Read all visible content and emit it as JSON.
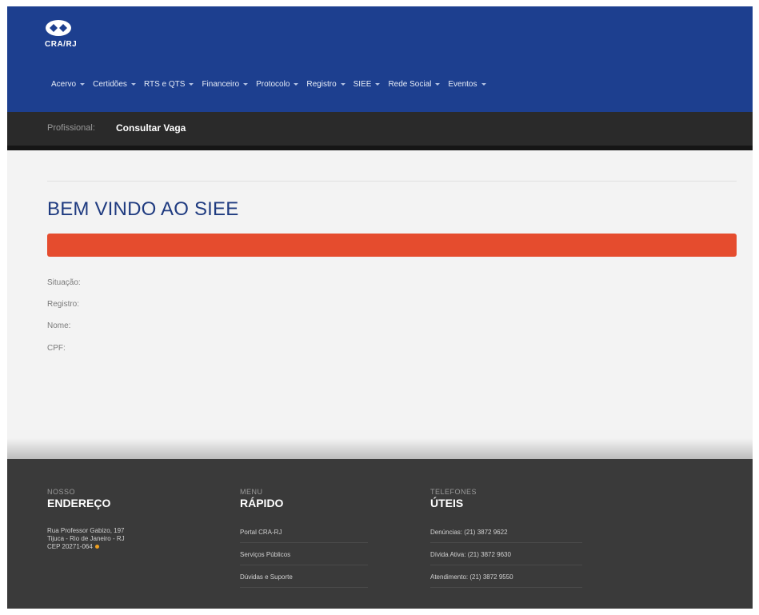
{
  "brand": {
    "logo_text": "CRA/RJ"
  },
  "nav": {
    "items": [
      {
        "label": "Acervo"
      },
      {
        "label": "Certidões"
      },
      {
        "label": "RTS e QTS"
      },
      {
        "label": "Financeiro"
      },
      {
        "label": "Protocolo"
      },
      {
        "label": "Registro"
      },
      {
        "label": "SIEE"
      },
      {
        "label": "Rede Social"
      },
      {
        "label": "Eventos"
      }
    ]
  },
  "breadcrumb": {
    "label": "Profissional:",
    "link": "Consultar Vaga"
  },
  "main": {
    "title": "BEM VINDO AO SIEE",
    "fields": [
      {
        "label": "Situação:"
      },
      {
        "label": "Registro:"
      },
      {
        "label": "Nome:"
      },
      {
        "label": "CPF:"
      }
    ]
  },
  "footer": {
    "address": {
      "small": "NOSSO",
      "big": "ENDEREÇO",
      "line1": "Rua Professor Gabizo, 197",
      "line2": "Tijuca - Rio de Janeiro - RJ",
      "line3": "CEP 20271-064"
    },
    "menu": {
      "small": "MENU",
      "big": "RÁPIDO",
      "links": [
        "Portal CRA-RJ",
        "Serviços Públicos",
        "Dúvidas e Suporte"
      ]
    },
    "phones": {
      "small": "TELEFONES",
      "big": "ÚTEIS",
      "items": [
        "Denúncias: (21) 3872 9622",
        "Dívida Ativa: (21) 3872 9630",
        "Atendimento: (21) 3872 9550"
      ]
    }
  },
  "colors": {
    "header": "#1d3f8f",
    "subbar": "#2a2a2a",
    "alert": "#e54c2e",
    "title": "#1f3b80",
    "footer": "#3a3a3a"
  }
}
